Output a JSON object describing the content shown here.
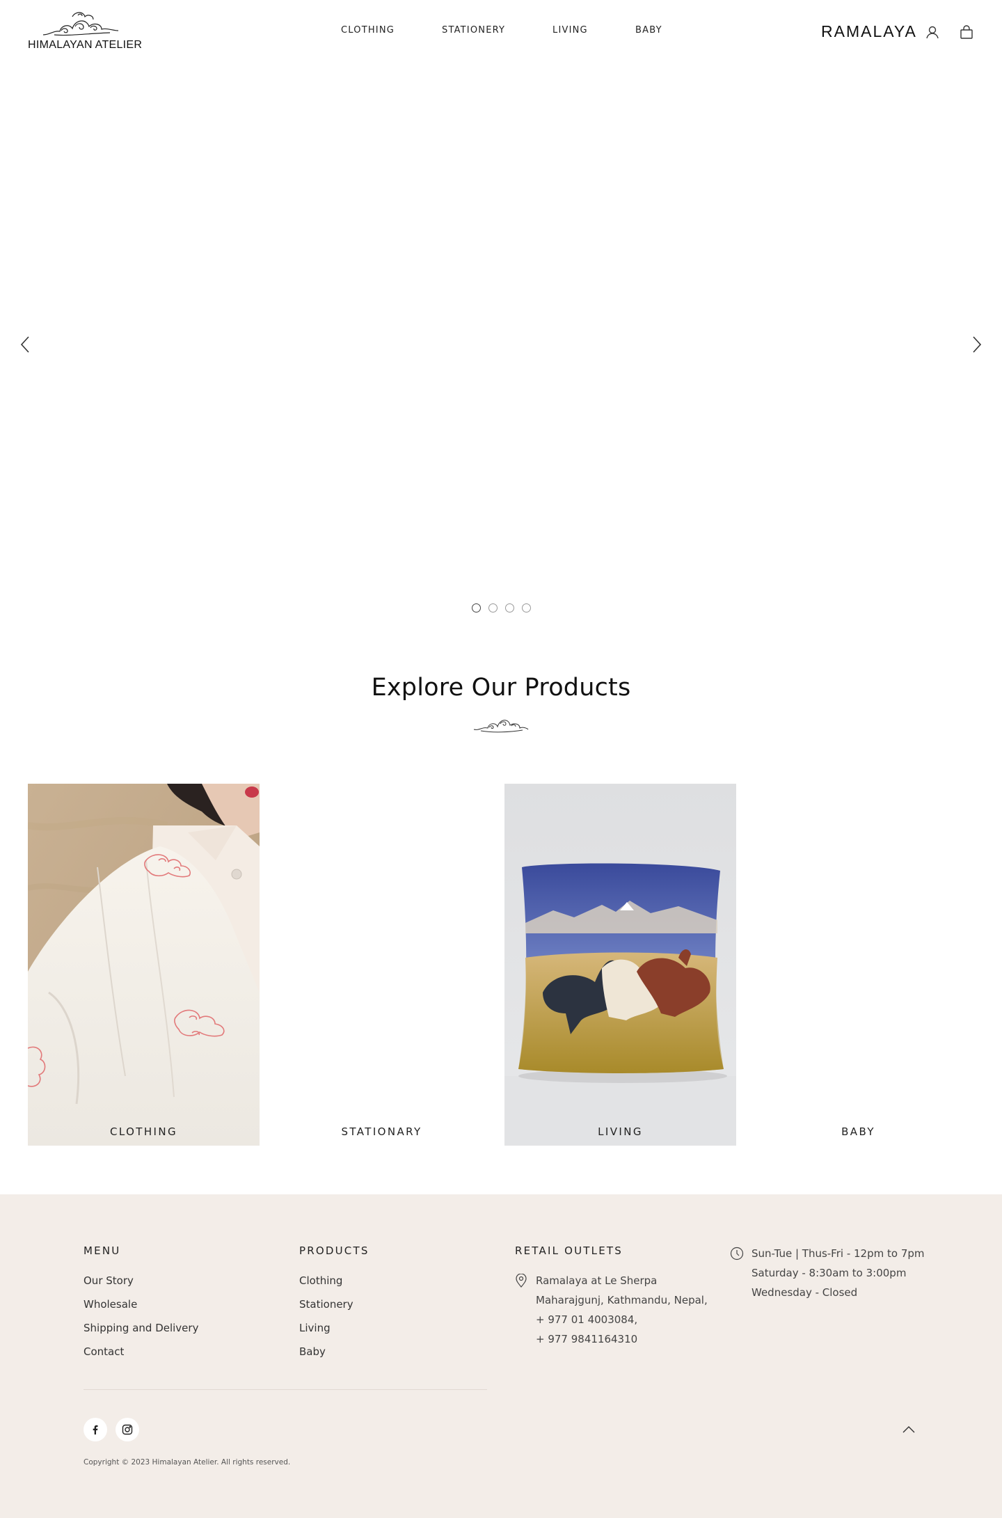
{
  "header": {
    "logo_text": "HIMALAYAN ATELIER",
    "nav": [
      "CLOTHING",
      "STATIONERY",
      "LIVING",
      "BABY"
    ],
    "brand_right": "RAMALAYA",
    "icons": [
      "account-icon",
      "cart-icon"
    ]
  },
  "hero": {
    "prev_icon": "chevron-left-icon",
    "next_icon": "chevron-right-icon",
    "slides_count": 4,
    "active_slide": 1
  },
  "explore": {
    "title": "Explore Our Products",
    "categories": [
      {
        "label": "CLOTHING"
      },
      {
        "label": "STATIONARY"
      },
      {
        "label": "LIVING"
      },
      {
        "label": "BABY"
      }
    ]
  },
  "footer": {
    "menu_heading": "MENU",
    "menu_items": [
      "Our Story",
      "Wholesale",
      "Shipping and Delivery",
      "Contact"
    ],
    "products_heading": "PRODUCTS",
    "product_items": [
      "Clothing",
      "Stationery",
      "Living",
      "Baby"
    ],
    "retail_heading": "RETAIL OUTLETS",
    "address_lines": [
      "Ramalaya at Le Sherpa",
      "Maharajgunj, Kathmandu, Nepal,",
      "+ 977 01 4003084,",
      "+ 977 9841164310"
    ],
    "hours_lines": [
      "Sun-Tue | Thus-Fri - 12pm to 7pm",
      "Saturday - 8:30am to 3:00pm",
      "Wednesday - Closed"
    ],
    "social": [
      "facebook-icon",
      "instagram-icon"
    ],
    "copyright": "Copyright © 2023 Himalayan Atelier. All rights reserved."
  },
  "colors": {
    "footer_bg": "#f3ede8",
    "embroidery": "#e2797a",
    "pillow_sky": "#3e4e9a",
    "pillow_ground": "#b5962e"
  }
}
